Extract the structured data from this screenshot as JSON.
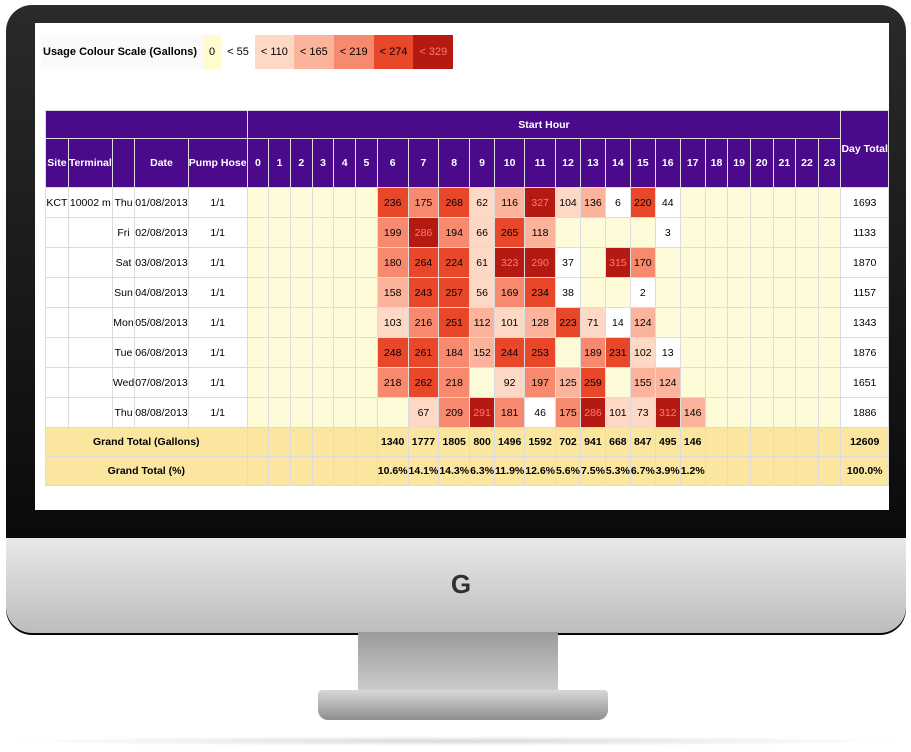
{
  "legend": {
    "label": "Usage Colour Scale (Gallons)",
    "items": [
      {
        "text": "0",
        "color": "#fffbcf",
        "textcolor": "#000000"
      },
      {
        "text": "< 55",
        "color": "#ffffff",
        "textcolor": "#000000"
      },
      {
        "text": "< 110",
        "color": "#fdd9c5",
        "textcolor": "#000000"
      },
      {
        "text": "< 165",
        "color": "#fbb39b",
        "textcolor": "#000000"
      },
      {
        "text": "< 219",
        "color": "#f78a6e",
        "textcolor": "#000000"
      },
      {
        "text": "< 274",
        "color": "#e8472a",
        "textcolor": "#000000"
      },
      {
        "text": "< 329",
        "color": "#b51a12",
        "textcolor": "#ff7a6a"
      }
    ]
  },
  "table": {
    "start_hour_label": "Start Hour",
    "day_total_label": "Day Total",
    "headers": {
      "site": "Site",
      "terminal": "Terminal",
      "date": "Date",
      "pump_hose": "Pump Hose"
    },
    "hours": [
      "0",
      "1",
      "2",
      "3",
      "4",
      "5",
      "6",
      "7",
      "8",
      "9",
      "10",
      "11",
      "12",
      "13",
      "14",
      "15",
      "16",
      "17",
      "18",
      "19",
      "20",
      "21",
      "22",
      "23"
    ],
    "rows": [
      {
        "site": "KCT",
        "terminal": "10002 m",
        "day": "Thu",
        "date": "01/08/2013",
        "hose": "1/1",
        "values": [
          "",
          "",
          "",
          "",
          "",
          "",
          "236",
          "175",
          "268",
          "62",
          "116",
          "327",
          "104",
          "136",
          "6",
          "220",
          "44",
          "",
          "",
          "",
          "",
          "",
          "",
          ""
        ],
        "total": "1693"
      },
      {
        "site": "",
        "terminal": "",
        "day": "Fri",
        "date": "02/08/2013",
        "hose": "1/1",
        "values": [
          "",
          "",
          "",
          "",
          "",
          "",
          "199",
          "286",
          "194",
          "66",
          "265",
          "118",
          "",
          "",
          "",
          "",
          "3",
          "",
          "",
          "",
          "",
          "",
          "",
          ""
        ],
        "total": "1133"
      },
      {
        "site": "",
        "terminal": "",
        "day": "Sat",
        "date": "03/08/2013",
        "hose": "1/1",
        "values": [
          "",
          "",
          "",
          "",
          "",
          "",
          "180",
          "264",
          "224",
          "61",
          "323",
          "290",
          "37",
          "",
          "315",
          "170",
          "",
          "",
          "",
          "",
          "",
          "",
          "",
          ""
        ],
        "total": "1870"
      },
      {
        "site": "",
        "terminal": "",
        "day": "Sun",
        "date": "04/08/2013",
        "hose": "1/1",
        "values": [
          "",
          "",
          "",
          "",
          "",
          "",
          "158",
          "243",
          "257",
          "56",
          "169",
          "234",
          "38",
          "",
          "",
          "2",
          "",
          "",
          "",
          "",
          "",
          "",
          "",
          ""
        ],
        "total": "1157"
      },
      {
        "site": "",
        "terminal": "",
        "day": "Mon",
        "date": "05/08/2013",
        "hose": "1/1",
        "values": [
          "",
          "",
          "",
          "",
          "",
          "",
          "103",
          "216",
          "251",
          "112",
          "101",
          "128",
          "223",
          "71",
          "14",
          "124",
          "",
          "",
          "",
          "",
          "",
          "",
          "",
          ""
        ],
        "total": "1343"
      },
      {
        "site": "",
        "terminal": "",
        "day": "Tue",
        "date": "06/08/2013",
        "hose": "1/1",
        "values": [
          "",
          "",
          "",
          "",
          "",
          "",
          "248",
          "261",
          "184",
          "152",
          "244",
          "253",
          "",
          "189",
          "231",
          "102",
          "13",
          "",
          "",
          "",
          "",
          "",
          "",
          ""
        ],
        "total": "1876"
      },
      {
        "site": "",
        "terminal": "",
        "day": "Wed",
        "date": "07/08/2013",
        "hose": "1/1",
        "values": [
          "",
          "",
          "",
          "",
          "",
          "",
          "218",
          "262",
          "218",
          "",
          "92",
          "197",
          "125",
          "259",
          "",
          "155",
          "124",
          "",
          "",
          "",
          "",
          "",
          "",
          ""
        ],
        "total": "1651"
      },
      {
        "site": "",
        "terminal": "",
        "day": "Thu",
        "date": "08/08/2013",
        "hose": "1/1",
        "values": [
          "",
          "",
          "",
          "",
          "",
          "",
          "",
          "67",
          "209",
          "291",
          "181",
          "46",
          "175",
          "286",
          "101",
          "73",
          "312",
          "146",
          "",
          "",
          "",
          "",
          "",
          ""
        ],
        "total": "1886"
      }
    ],
    "grand_total_gallons": {
      "label": "Grand Total (Gallons)",
      "values": [
        "",
        "",
        "",
        "",
        "",
        "",
        "1340",
        "1777",
        "1805",
        "800",
        "1496",
        "1592",
        "702",
        "941",
        "668",
        "847",
        "495",
        "146",
        "",
        "",
        "",
        "",
        "",
        ""
      ],
      "total": "12609"
    },
    "grand_total_percent": {
      "label": "Grand Total (%)",
      "values": [
        "",
        "",
        "",
        "",
        "",
        "",
        "10.6%",
        "14.1%",
        "14.3%",
        "6.3%",
        "11.9%",
        "12.6%",
        "5.6%",
        "7.5%",
        "5.3%",
        "6.7%",
        "3.9%",
        "1.2%",
        "",
        "",
        "",
        "",
        "",
        ""
      ],
      "total": "100.0%"
    }
  },
  "colors": {
    "header": "#4b0a8b",
    "empty_cell": "#fdfbd8",
    "total_row": "#fbe6a0"
  },
  "brand_icon": "g-logo-icon"
}
